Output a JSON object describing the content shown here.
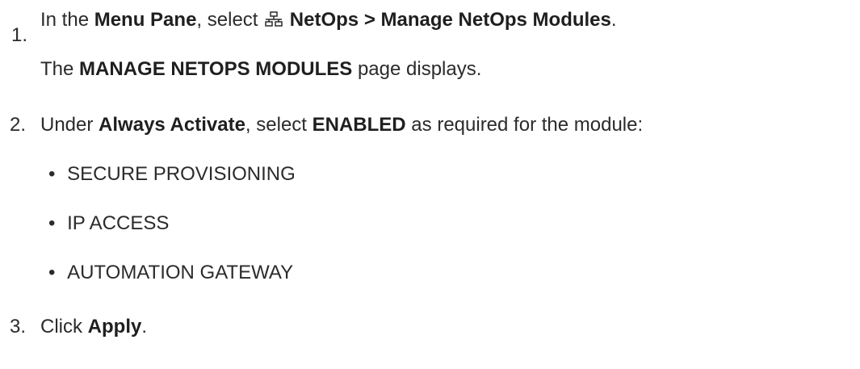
{
  "steps": [
    {
      "number": "1.",
      "parts": {
        "t1": "In the ",
        "b1": "Menu Pane",
        "t2": ", select ",
        "icon": "network-icon",
        "b2": "NetOps > Manage NetOps Modules",
        "t3": "."
      },
      "result": {
        "t1": "The ",
        "b1": "MANAGE NETOPS MODULES",
        "t2": " page displays."
      }
    },
    {
      "number": "2.",
      "parts": {
        "t1": "Under ",
        "b1": "Always Activate",
        "t2": ", select ",
        "b2": "ENABLED",
        "t3": " as required for the module:"
      },
      "bullets": [
        "SECURE PROVISIONING",
        "IP ACCESS",
        "AUTOMATION GATEWAY"
      ]
    },
    {
      "number": "3.",
      "parts": {
        "t1": "Click ",
        "b1": "Apply",
        "t2": "."
      }
    }
  ],
  "bullet_glyph": "•"
}
